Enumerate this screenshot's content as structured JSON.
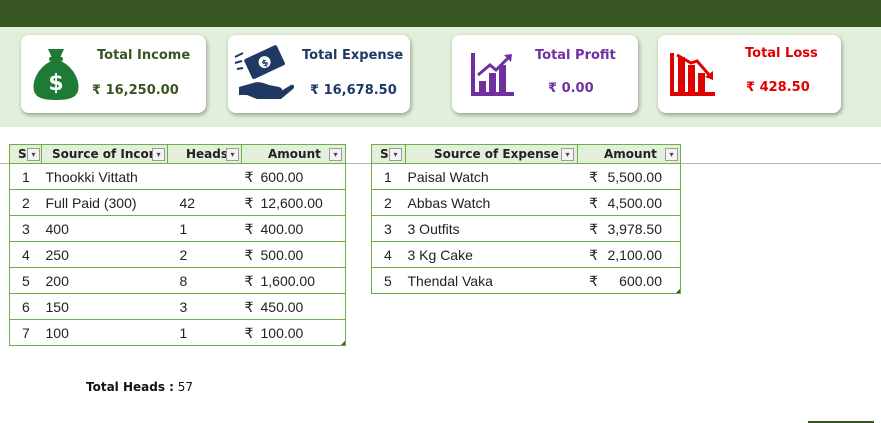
{
  "summary_cards": {
    "income": {
      "title": "Total Income",
      "value": "₹ 16,250.00",
      "icon": "money-bag-icon",
      "title_color": "#375623",
      "value_color": "#375623"
    },
    "expense": {
      "title": "Total Expense",
      "value": "₹ 16,678.50",
      "icon": "hand-money-icon",
      "title_color": "#1f3864",
      "value_color": "#1f3864"
    },
    "profit": {
      "title": "Total Profit",
      "value": "₹ 0.00",
      "icon": "bar-chart-up-icon",
      "title_color": "#7030a0",
      "value_color": "#7030a0"
    },
    "loss": {
      "title": "Total Loss",
      "value": "₹ 428.50",
      "icon": "bar-chart-down-icon",
      "title_color": "#e00000",
      "value_color": "#e00000"
    }
  },
  "income_table": {
    "headers": {
      "sno": "S",
      "source": "Source of Incom",
      "heads": "Heads",
      "amount": "Amount"
    },
    "rows": [
      {
        "sno": "1",
        "source": "Thookki Vittath",
        "heads": "",
        "rupee": "₹",
        "amount": "600.00"
      },
      {
        "sno": "2",
        "source": "Full Paid (300)",
        "heads": "42",
        "rupee": "₹",
        "amount": "12,600.00"
      },
      {
        "sno": "3",
        "source": "400",
        "heads": "1",
        "rupee": "₹",
        "amount": "400.00"
      },
      {
        "sno": "4",
        "source": "250",
        "heads": "2",
        "rupee": "₹",
        "amount": "500.00"
      },
      {
        "sno": "5",
        "source": "200",
        "heads": "8",
        "rupee": "₹",
        "amount": "1,600.00"
      },
      {
        "sno": "6",
        "source": "150",
        "heads": "3",
        "rupee": "₹",
        "amount": "450.00"
      },
      {
        "sno": "7",
        "source": "100",
        "heads": "1",
        "rupee": "₹",
        "amount": "100.00"
      }
    ]
  },
  "expense_table": {
    "headers": {
      "sno": "S",
      "source": "Source of Expense",
      "amount": "Amount"
    },
    "rows": [
      {
        "sno": "1",
        "source": "Paisal Watch",
        "rupee": "₹",
        "amount": "5,500.00"
      },
      {
        "sno": "2",
        "source": "Abbas Watch",
        "rupee": "₹",
        "amount": "4,500.00"
      },
      {
        "sno": "3",
        "source": "3 Outfits",
        "rupee": "₹",
        "amount": "3,978.50"
      },
      {
        "sno": "4",
        "source": "3 Kg Cake",
        "rupee": "₹",
        "amount": "2,100.00"
      },
      {
        "sno": "5",
        "source": "Thendal Vaka",
        "rupee": "₹",
        "amount": "600.00"
      }
    ]
  },
  "total_heads": {
    "label": "Total Heads :",
    "value": "57"
  },
  "dropdown_glyph": "▾",
  "colors": {
    "dark_green": "#375623",
    "light_green": "#e2efda",
    "table_border": "#70ad47"
  }
}
